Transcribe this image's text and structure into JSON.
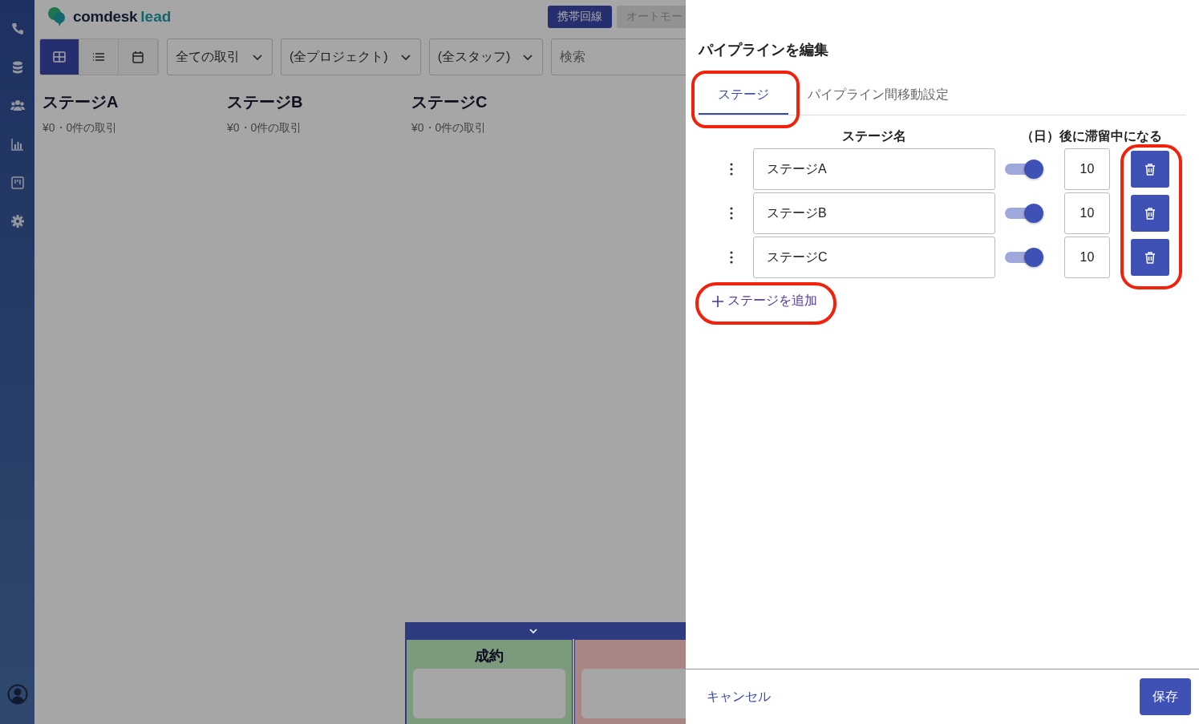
{
  "header": {
    "logo_name": "comdesk",
    "logo_suffix": "lead",
    "buttons": [
      {
        "label": "携帯回線",
        "disabled": false
      },
      {
        "label": "オートモー",
        "disabled": true
      }
    ]
  },
  "view_modes": [
    {
      "kind": "board",
      "selected": true
    },
    {
      "kind": "list",
      "selected": false
    },
    {
      "kind": "calendar",
      "selected": false
    }
  ],
  "filters": [
    {
      "kind": "select",
      "value": "全ての取引"
    },
    {
      "kind": "select",
      "value": "(全プロジェクト)"
    },
    {
      "kind": "select",
      "value": "(全スタッフ)"
    },
    {
      "kind": "search",
      "placeholder": "検索"
    }
  ],
  "stages": [
    {
      "name": "ステージA",
      "summary": "¥0・0件の取引"
    },
    {
      "name": "ステージB",
      "summary": "¥0・0件の取引"
    },
    {
      "name": "ステージC",
      "summary": "¥0・0件の取引"
    }
  ],
  "outcome_columns": [
    {
      "title": "成約",
      "color": "#7c9a7c"
    },
    {
      "color": "#a98683"
    }
  ],
  "drawer": {
    "title": "パイプラインを編集",
    "tabs": [
      {
        "label": "ステージ",
        "selected": true,
        "highlighted": true
      },
      {
        "label": "パイプライン間移動設定",
        "selected": false,
        "highlighted": false
      }
    ],
    "column_name": "ステージ名",
    "column_stall": "（日）後に滞留中になる",
    "rows": [
      {
        "name": "ステージA",
        "on": true,
        "days": "10"
      },
      {
        "name": "ステージB",
        "on": true,
        "days": "10"
      },
      {
        "name": "ステージC",
        "on": true,
        "days": "10"
      }
    ],
    "delete_highlighted": true,
    "add_label": "ステージを追加",
    "add_highlighted": true,
    "cancel": "キャンセル",
    "save": "保存"
  }
}
